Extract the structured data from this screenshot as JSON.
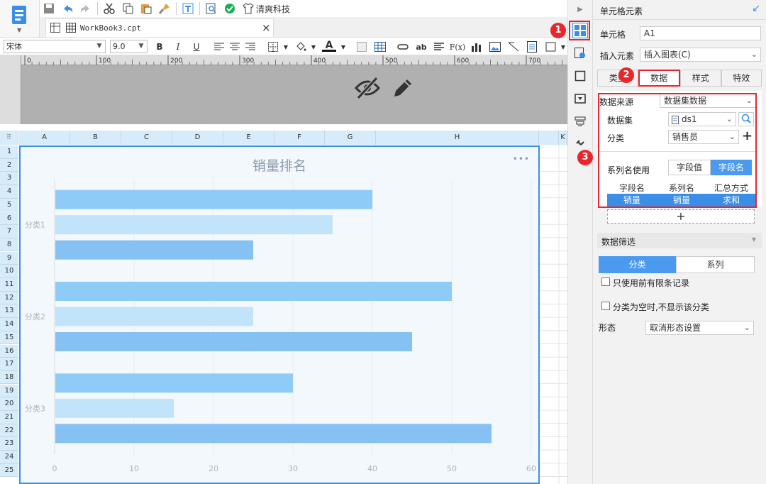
{
  "toolbar": {
    "brand_label": "清爽科技",
    "icons": [
      "save-icon",
      "undo-icon",
      "redo-icon",
      "cut-icon",
      "copy-icon",
      "paste-icon",
      "format-brush-icon",
      "preview-icon",
      "search-doc-icon",
      "check-icon",
      "shirt-icon"
    ]
  },
  "tab": {
    "title": "WorkBook3.cpt",
    "close": "×"
  },
  "format": {
    "font": "宋体",
    "size": "9.0",
    "bold": "B",
    "italic": "I",
    "underline": "U",
    "text_color_letter": "A",
    "ab": "ab",
    "fx": "F(x)"
  },
  "ruler": {
    "ticks": [
      "0",
      "100",
      "200",
      "300",
      "400",
      "500",
      "600",
      "700"
    ]
  },
  "sheet": {
    "columns": [
      "A",
      "B",
      "C",
      "D",
      "E",
      "F",
      "G",
      "H",
      "K"
    ],
    "rows": [
      "1",
      "2",
      "3",
      "4",
      "5",
      "6",
      "7",
      "8",
      "9",
      "10",
      "11",
      "12",
      "13",
      "14",
      "15",
      "16",
      "17",
      "18",
      "19",
      "20",
      "21",
      "22",
      "23",
      "24",
      "25"
    ]
  },
  "chart_data": {
    "type": "bar",
    "orientation": "horizontal",
    "title": "销量排名",
    "categories": [
      "分类1",
      "分类2",
      "分类3"
    ],
    "series": [
      {
        "values": [
          40,
          50,
          30
        ],
        "color": "#8ecbf7"
      },
      {
        "values": [
          35,
          25,
          15
        ],
        "color": "#c2e4fb"
      },
      {
        "values": [
          25,
          45,
          55
        ],
        "color": "#86c1f4"
      }
    ],
    "xlim": [
      0,
      60
    ],
    "xticks": [
      "0",
      "10",
      "20",
      "30",
      "40",
      "50",
      "60"
    ],
    "menu": "•••"
  },
  "panel": {
    "title": "单元格元素",
    "cell_label": "单元格",
    "cell_value": "A1",
    "insert_label": "插入元素",
    "insert_value": "插入图表(C)",
    "tabs": {
      "type": "类型",
      "data": "数据",
      "style": "样式",
      "effect": "特效"
    },
    "source_label": "数据来源",
    "source_value": "数据集数据",
    "dataset_label": "数据集",
    "dataset_value": "ds1",
    "category_label": "分类",
    "category_value": "销售员",
    "series_name_label": "系列名使用",
    "series_opt_value": "字段值",
    "series_opt_field": "字段名",
    "table_headers": [
      "字段名",
      "系列名",
      "汇总方式"
    ],
    "table_row": [
      "销量",
      "销量",
      "求和"
    ],
    "add": "+",
    "filter_label": "数据筛选",
    "filter_tab_category": "分类",
    "filter_tab_series": "系列",
    "check1": "只使用前有限条记录",
    "check2": "分类为空时,不显示该分类",
    "shape_label": "形态",
    "shape_value": "取消形态设置"
  },
  "badges": [
    "1",
    "2",
    "3"
  ],
  "colors": {
    "accent": "#3a8ee6",
    "badge": "#e8262b",
    "selected_tab": "#4a9af0"
  }
}
